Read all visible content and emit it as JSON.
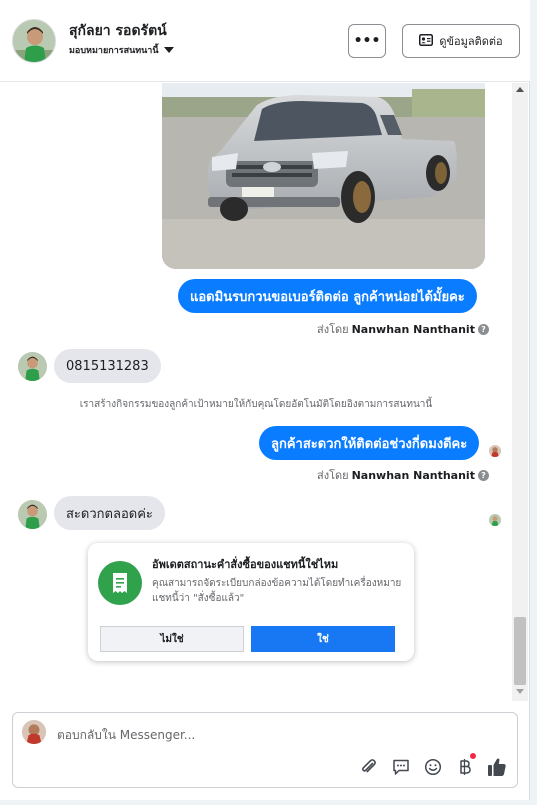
{
  "header": {
    "contact_name": "สุกัลยา รอดรัตน์",
    "assign_label": "มอบหมายการสนทนานี้",
    "more_label": "•••",
    "view_contact_label": "ดูข้อมูลติดต่อ"
  },
  "messages": {
    "outgoing_1": "แอดมินรบกวนขอเบอร์ติดต่อ ลูกค้าหน่อยได้มั้ยคะ",
    "sent_by_prefix": "ส่งโดย",
    "sent_by_name": "Nanwhan Nanthanit",
    "incoming_phone": "0815131283",
    "system_note": "เราสร้างกิจกรรมของลูกค้าเป้าหมายให้กับคุณโดยอัตโนมัติโดยอิงตามการสนทนานี้",
    "outgoing_2": "ลูกค้าสะดวกให้ติดต่อช่วงกี่ดมงดีคะ",
    "incoming_2": "สะดวกตลอดค่ะ",
    "info_glyph": "?"
  },
  "prompt_card": {
    "title": "อัพเดตสถานะคำสั่งซื้อของแชทนี้ใช่ไหม",
    "body": "คุณสามารถจัดระเบียบกล่องข้อความได้โดยทำเครื่องหมายแชทนี้ว่า \"สั่งซื้อแล้ว\"",
    "no_label": "ไม่ใช่",
    "yes_label": "ใช่"
  },
  "composer": {
    "placeholder": "ตอบกลับใน Messenger...",
    "icons": [
      "paperclip-icon",
      "saved-reply-icon",
      "emoji-icon",
      "baht-payment-icon",
      "thumbs-up-icon"
    ]
  },
  "colors": {
    "outgoing_bubble": "#0a7cff",
    "incoming_bubble": "#e4e6eb",
    "yes_button": "#1877f2",
    "card_icon": "#31a24c"
  }
}
